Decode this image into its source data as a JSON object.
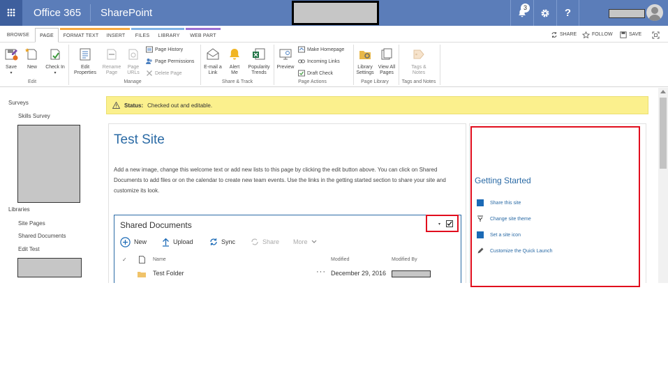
{
  "suite": {
    "app_name": "Office 365",
    "product": "SharePoint",
    "notification_count": "3",
    "help_label": "?"
  },
  "ribbon_tabs": [
    {
      "label": "BROWSE"
    },
    {
      "label": "PAGE"
    },
    {
      "label": "FORMAT TEXT"
    },
    {
      "label": "INSERT"
    },
    {
      "label": "FILES"
    },
    {
      "label": "LIBRARY"
    },
    {
      "label": "WEB PART"
    }
  ],
  "ribbon_actions": {
    "share": "SHARE",
    "follow": "FOLLOW",
    "save": "SAVE"
  },
  "ribbon": {
    "edit": {
      "save": "Save",
      "new": "New",
      "check_in": "Check In",
      "group": "Edit"
    },
    "manage": {
      "edit_properties": "Edit Properties",
      "rename_page": "Rename Page",
      "page_urls": "Page URLs",
      "page_history": "Page History",
      "page_permissions": "Page Permissions",
      "delete_page": "Delete Page",
      "group": "Manage"
    },
    "share_track": {
      "email_link": "E-mail a Link",
      "alert_me": "Alert Me",
      "popularity_trends": "Popularity Trends",
      "group": "Share & Track"
    },
    "page_actions": {
      "preview": "Preview",
      "make_homepage": "Make Homepage",
      "incoming_links": "Incoming Links",
      "draft_check": "Draft Check",
      "group": "Page Actions"
    },
    "page_library": {
      "library_settings": "Library Settings",
      "view_all_pages": "View All Pages",
      "group": "Page Library"
    },
    "tags_notes": {
      "tags_notes": "Tags & Notes",
      "group": "Tags and Notes"
    }
  },
  "nav": {
    "surveys": "Surveys",
    "skills_survey": "Skills Survey",
    "libraries": "Libraries",
    "site_pages": "Site Pages",
    "shared_documents": "Shared Documents",
    "edit_test": "Edit Test"
  },
  "status": {
    "label": "Status:",
    "text": "Checked out and editable."
  },
  "main": {
    "title": "Test Site",
    "welcome": "Add a new image, change this welcome text or add new lists to this page by clicking the edit button above. You can click on Shared Documents to add files or on the calendar to create new team events. Use the links in the getting started section to share your site and customize its look."
  },
  "doclib": {
    "title": "Shared Documents",
    "commands": {
      "new": "New",
      "upload": "Upload",
      "sync": "Sync",
      "share": "Share",
      "more": "More"
    },
    "columns": {
      "name": "Name",
      "modified": "Modified",
      "modified_by": "Modified By"
    },
    "rows": [
      {
        "name": "Test Folder",
        "modified": "December 29, 2016"
      }
    ]
  },
  "getting_started": {
    "title": "Getting Started",
    "items": [
      "Share this site",
      "Change site theme",
      "Set a site icon",
      "Customize the Quick Launch"
    ]
  },
  "colors": {
    "suite_bar": "#5b7db9",
    "accent": "#2a6aa5",
    "status_bg": "#fbf08d",
    "highlight": "#e10d1d"
  }
}
